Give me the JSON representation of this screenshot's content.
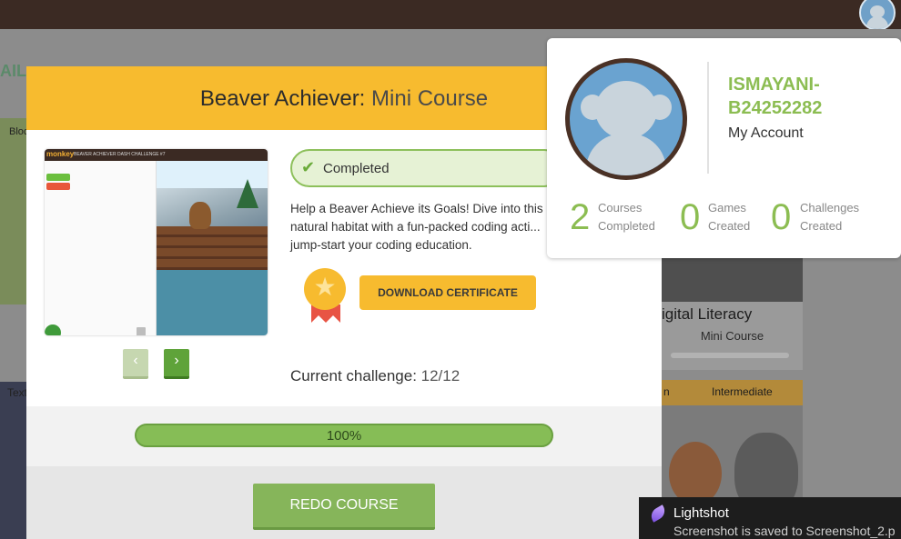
{
  "background": {
    "tail_text": "AIL",
    "left_card_label": "Bloc",
    "left_card_label2": "Text",
    "right_card_title": "igital Literacy",
    "right_card_sub": "Mini Course",
    "right_card2_level_left": "n",
    "right_card2_level": "Intermediate"
  },
  "modal": {
    "title_bold": "Beaver Achiever:",
    "title_light": " Mini Course",
    "status_label": "Completed",
    "description": "Help a Beaver Achieve its Goals! Dive into this natural habitat with a fun-packed coding acti... jump-start your coding education.",
    "download_label": "DOWNLOAD CERTIFICATE",
    "challenge_label": "Current challenge:",
    "challenge_value": " 12/12",
    "progress": {
      "percent": 100,
      "label": "100%"
    },
    "redo_label": "REDO COURSE",
    "preview": {
      "logo_text": "monkey",
      "header_text": "BEAVER ACHIEVER DASH CHALLENGE #7"
    },
    "nav": {
      "prev_icon": "‹",
      "next_icon": "›"
    }
  },
  "account_popup": {
    "username": "ISMAYANI-B24252282",
    "my_account_label": "My Account",
    "stats": [
      {
        "value": "2",
        "label": "Courses Completed"
      },
      {
        "value": "0",
        "label": "Games Created"
      },
      {
        "value": "0",
        "label": "Challenges Created"
      }
    ]
  },
  "toast": {
    "title": "Lightshot",
    "message": "Screenshot is saved to Screenshot_2.p"
  },
  "colors": {
    "accent_yellow": "#f7bb2f",
    "accent_green": "#8cbd52",
    "topbar": "#3b2a23"
  }
}
